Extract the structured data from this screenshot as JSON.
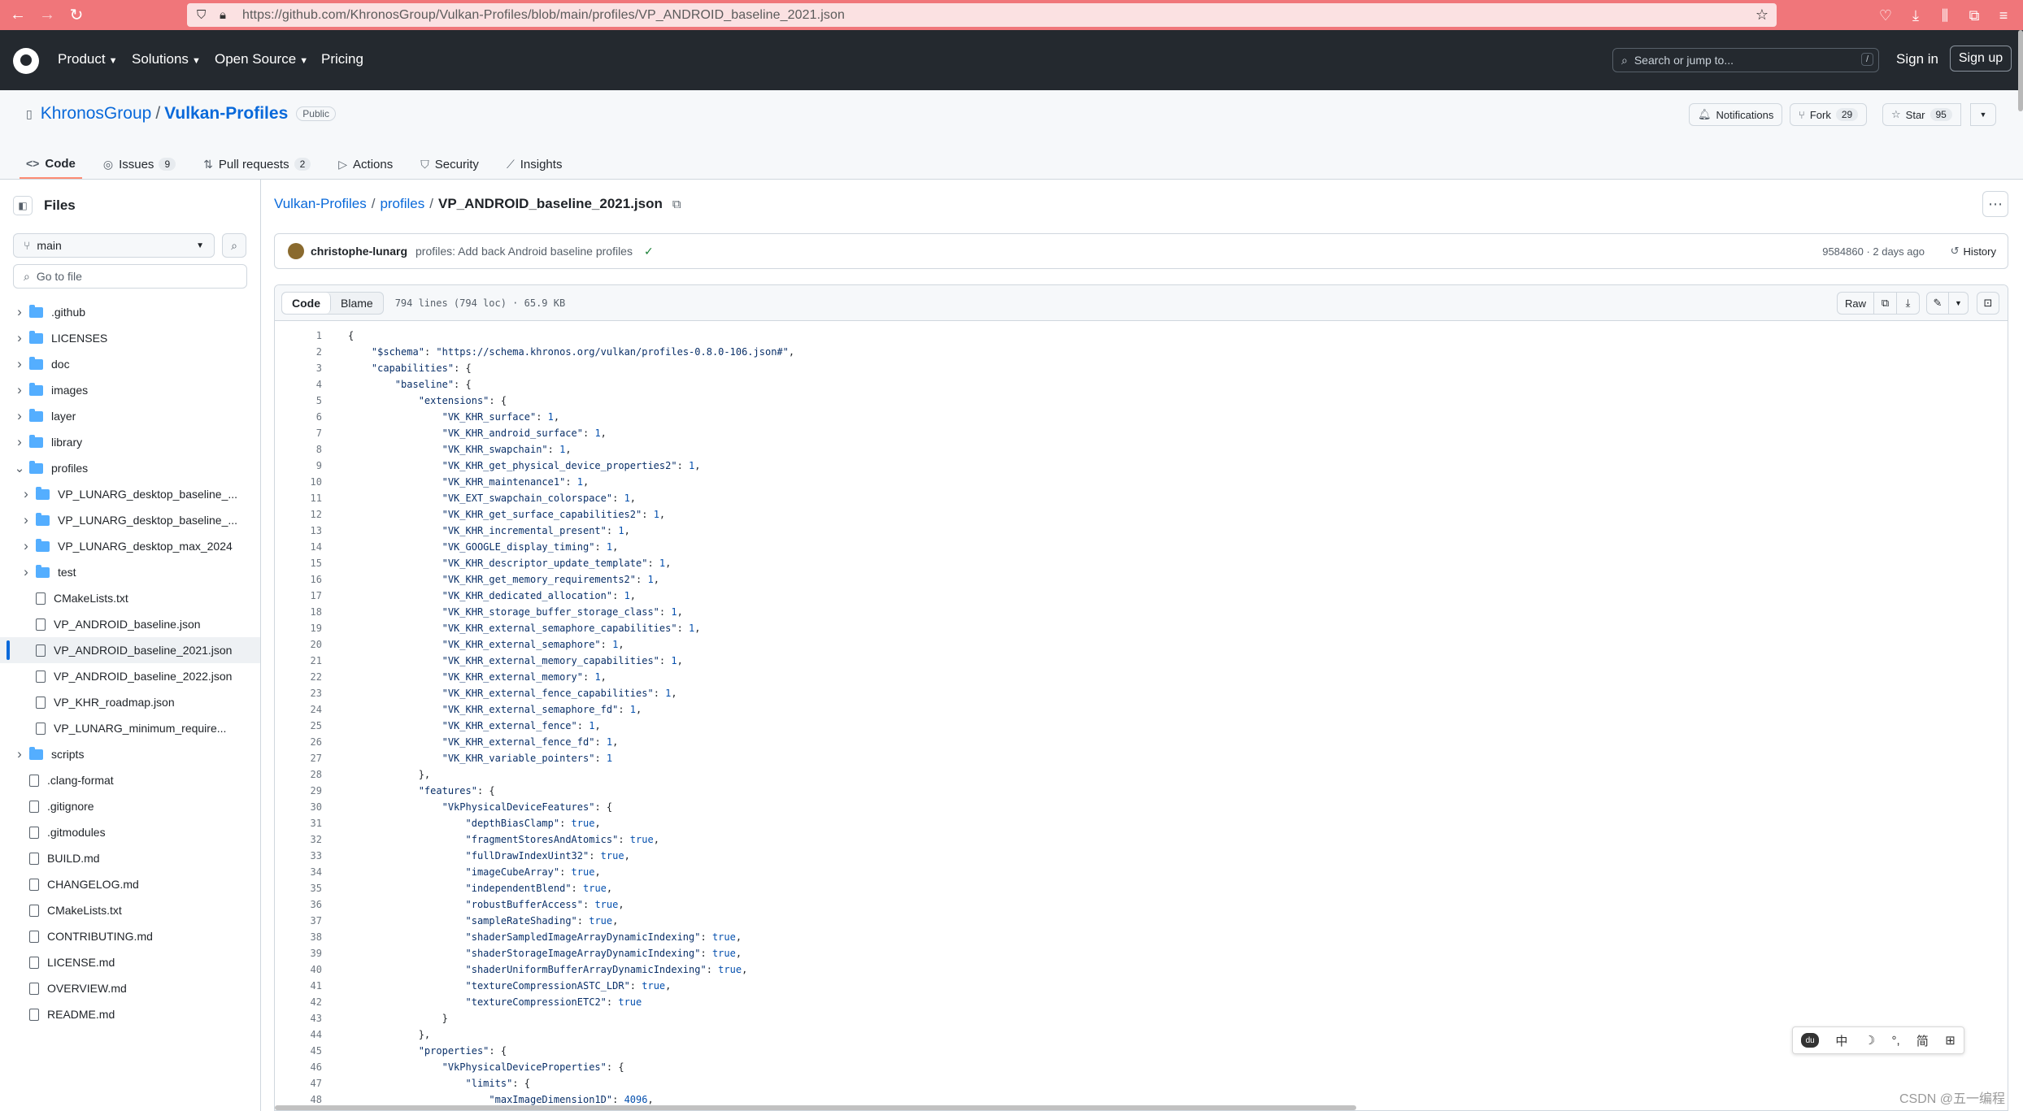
{
  "browser": {
    "url": "https://github.com/KhronosGroup/Vulkan-Profiles/blob/main/profiles/VP_ANDROID_baseline_2021.json"
  },
  "header": {
    "nav": [
      "Product",
      "Solutions",
      "Open Source",
      "Pricing"
    ],
    "search_placeholder": "Search or jump to...",
    "search_key": "/",
    "sign_in": "Sign in",
    "sign_up": "Sign up"
  },
  "repo": {
    "owner": "KhronosGroup",
    "separator": "/",
    "name": "Vulkan-Profiles",
    "visibility": "Public",
    "notifications": "Notifications",
    "fork_label": "Fork",
    "fork_count": "29",
    "star_label": "Star",
    "star_count": "95",
    "tabs": [
      {
        "label": "Code",
        "icon": "code-icon"
      },
      {
        "label": "Issues",
        "icon": "issue-icon",
        "count": "9"
      },
      {
        "label": "Pull requests",
        "icon": "pull-request-icon",
        "count": "2"
      },
      {
        "label": "Actions",
        "icon": "play-icon"
      },
      {
        "label": "Security",
        "icon": "shield-icon"
      },
      {
        "label": "Insights",
        "icon": "graph-icon"
      }
    ]
  },
  "sidebar": {
    "title": "Files",
    "branch": "main",
    "goto_placeholder": "Go to file",
    "tree": [
      {
        "label": ".github",
        "type": "folder",
        "depth": 0
      },
      {
        "label": "LICENSES",
        "type": "folder",
        "depth": 0
      },
      {
        "label": "doc",
        "type": "folder",
        "depth": 0
      },
      {
        "label": "images",
        "type": "folder",
        "depth": 0
      },
      {
        "label": "layer",
        "type": "folder",
        "depth": 0
      },
      {
        "label": "library",
        "type": "folder",
        "depth": 0
      },
      {
        "label": "profiles",
        "type": "folder-open",
        "depth": 0
      },
      {
        "label": "VP_LUNARG_desktop_baseline_...",
        "type": "folder",
        "depth": 1
      },
      {
        "label": "VP_LUNARG_desktop_baseline_...",
        "type": "folder",
        "depth": 1
      },
      {
        "label": "VP_LUNARG_desktop_max_2024",
        "type": "folder",
        "depth": 1
      },
      {
        "label": "test",
        "type": "folder",
        "depth": 1
      },
      {
        "label": "CMakeLists.txt",
        "type": "file",
        "depth": 1
      },
      {
        "label": "VP_ANDROID_baseline.json",
        "type": "file",
        "depth": 1
      },
      {
        "label": "VP_ANDROID_baseline_2021.json",
        "type": "file",
        "depth": 1,
        "active": true
      },
      {
        "label": "VP_ANDROID_baseline_2022.json",
        "type": "file",
        "depth": 1
      },
      {
        "label": "VP_KHR_roadmap.json",
        "type": "file",
        "depth": 1
      },
      {
        "label": "VP_LUNARG_minimum_require...",
        "type": "file",
        "depth": 1
      },
      {
        "label": "scripts",
        "type": "folder",
        "depth": 0
      },
      {
        "label": ".clang-format",
        "type": "file",
        "depth": 0
      },
      {
        "label": ".gitignore",
        "type": "file",
        "depth": 0
      },
      {
        "label": ".gitmodules",
        "type": "file",
        "depth": 0
      },
      {
        "label": "BUILD.md",
        "type": "file",
        "depth": 0
      },
      {
        "label": "CHANGELOG.md",
        "type": "file",
        "depth": 0
      },
      {
        "label": "CMakeLists.txt",
        "type": "file",
        "depth": 0
      },
      {
        "label": "CONTRIBUTING.md",
        "type": "file",
        "depth": 0
      },
      {
        "label": "LICENSE.md",
        "type": "file",
        "depth": 0
      },
      {
        "label": "OVERVIEW.md",
        "type": "file",
        "depth": 0
      },
      {
        "label": "README.md",
        "type": "file",
        "depth": 0
      }
    ]
  },
  "breadcrumb": {
    "repo": "Vulkan-Profiles",
    "folder": "profiles",
    "file": "VP_ANDROID_baseline_2021.json"
  },
  "commit": {
    "author": "christophe-lunarg",
    "message": "profiles: Add back Android baseline profiles",
    "meta": "9584860 · 2 days ago",
    "history": "History"
  },
  "code_view": {
    "tab_code": "Code",
    "tab_blame": "Blame",
    "info": "794 lines (794 loc) · 65.9 KB",
    "raw": "Raw",
    "lines": [
      "{",
      "    \"$schema\": \"https://schema.khronos.org/vulkan/profiles-0.8.0-106.json#\",",
      "    \"capabilities\": {",
      "        \"baseline\": {",
      "            \"extensions\": {",
      "                \"VK_KHR_surface\": 1,",
      "                \"VK_KHR_android_surface\": 1,",
      "                \"VK_KHR_swapchain\": 1,",
      "                \"VK_KHR_get_physical_device_properties2\": 1,",
      "                \"VK_KHR_maintenance1\": 1,",
      "                \"VK_EXT_swapchain_colorspace\": 1,",
      "                \"VK_KHR_get_surface_capabilities2\": 1,",
      "                \"VK_KHR_incremental_present\": 1,",
      "                \"VK_GOOGLE_display_timing\": 1,",
      "                \"VK_KHR_descriptor_update_template\": 1,",
      "                \"VK_KHR_get_memory_requirements2\": 1,",
      "                \"VK_KHR_dedicated_allocation\": 1,",
      "                \"VK_KHR_storage_buffer_storage_class\": 1,",
      "                \"VK_KHR_external_semaphore_capabilities\": 1,",
      "                \"VK_KHR_external_semaphore\": 1,",
      "                \"VK_KHR_external_memory_capabilities\": 1,",
      "                \"VK_KHR_external_memory\": 1,",
      "                \"VK_KHR_external_fence_capabilities\": 1,",
      "                \"VK_KHR_external_semaphore_fd\": 1,",
      "                \"VK_KHR_external_fence\": 1,",
      "                \"VK_KHR_external_fence_fd\": 1,",
      "                \"VK_KHR_variable_pointers\": 1",
      "            },",
      "            \"features\": {",
      "                \"VkPhysicalDeviceFeatures\": {",
      "                    \"depthBiasClamp\": true,",
      "                    \"fragmentStoresAndAtomics\": true,",
      "                    \"fullDrawIndexUint32\": true,",
      "                    \"imageCubeArray\": true,",
      "                    \"independentBlend\": true,",
      "                    \"robustBufferAccess\": true,",
      "                    \"sampleRateShading\": true,",
      "                    \"shaderSampledImageArrayDynamicIndexing\": true,",
      "                    \"shaderStorageImageArrayDynamicIndexing\": true,",
      "                    \"shaderUniformBufferArrayDynamicIndexing\": true,",
      "                    \"textureCompressionASTC_LDR\": true,",
      "                    \"textureCompressionETC2\": true",
      "                }",
      "            },",
      "            \"properties\": {",
      "                \"VkPhysicalDeviceProperties\": {",
      "                    \"limits\": {",
      "                        \"maxImageDimension1D\": 4096,"
    ]
  },
  "ime": {
    "items": [
      "中",
      "☽",
      "°,",
      "简",
      "⊞"
    ]
  },
  "watermark": "CSDN @五一编程"
}
